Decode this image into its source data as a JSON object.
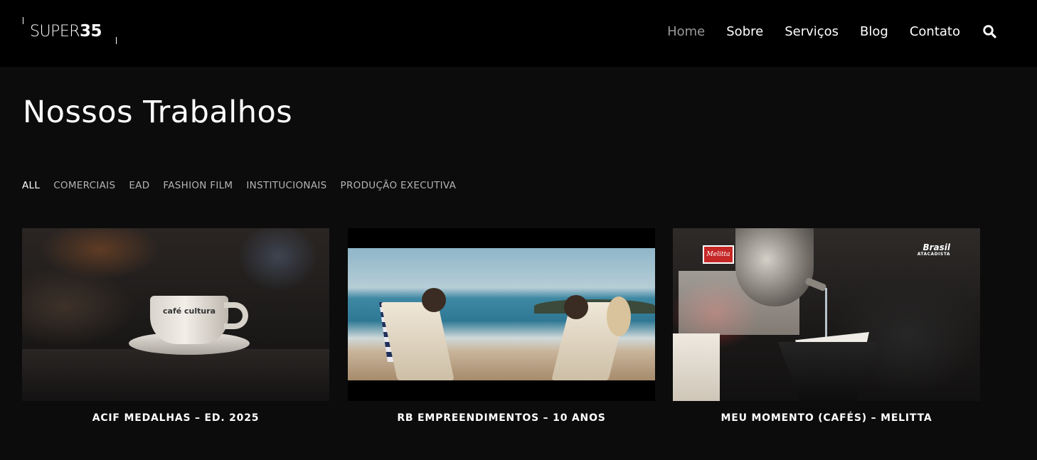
{
  "header": {
    "logo": {
      "light": "SUPER",
      "bold": "35"
    },
    "nav": [
      {
        "label": "Home",
        "active": true
      },
      {
        "label": "Sobre",
        "active": false
      },
      {
        "label": "Serviços",
        "active": false
      },
      {
        "label": "Blog",
        "active": false
      },
      {
        "label": "Contato",
        "active": false
      }
    ],
    "search_icon": "search-icon"
  },
  "main": {
    "title": "Nossos Trabalhos",
    "filters": [
      {
        "label": "ALL",
        "active": true
      },
      {
        "label": "COMERCIAIS",
        "active": false
      },
      {
        "label": "EAD",
        "active": false
      },
      {
        "label": "FASHION FILM",
        "active": false
      },
      {
        "label": "INSTITUCIONAIS",
        "active": false
      },
      {
        "label": "PRODUÇÃO EXECUTIVA",
        "active": false
      }
    ],
    "projects": [
      {
        "caption": "ACIF MEDALHAS – ED. 2025",
        "thumb_text": "café cultura"
      },
      {
        "caption": "RB EMPREENDIMENTOS – 10 ANOS"
      },
      {
        "caption": "MEU MOMENTO (CAFÉS) – MELITTA",
        "thumb_text": "Melitta",
        "thumb_brand": "Brasil",
        "thumb_brand_sub": "ATACADISTA"
      }
    ]
  },
  "colors": {
    "header_bg": "#000000",
    "page_bg": "#0c0c0c",
    "nav_active": "#9a9a9a",
    "filter_inactive": "#b4b4b4",
    "text": "#ffffff"
  }
}
